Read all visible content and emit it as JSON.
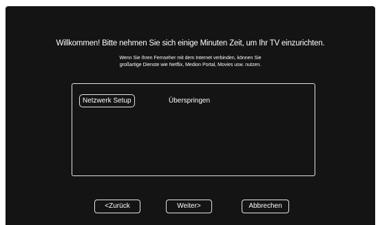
{
  "welcome_text": "Willkommen! Bitte nehmen Sie sich einige Minuten Zeit, um Ihr TV einzurichten.",
  "description": {
    "line1": "Wenn Sie Ihren Fernseher mit dem Internet verbinden, können Sie",
    "line2": "großartige Dienste wie Netflix, Medion Portal, Movies usw. nutzen."
  },
  "options": {
    "network_setup": "Netzwerk Setup",
    "skip": "Überspringen"
  },
  "buttons": {
    "back": "<Zurück",
    "next": "Weiter>",
    "cancel": "Abbrechen"
  }
}
